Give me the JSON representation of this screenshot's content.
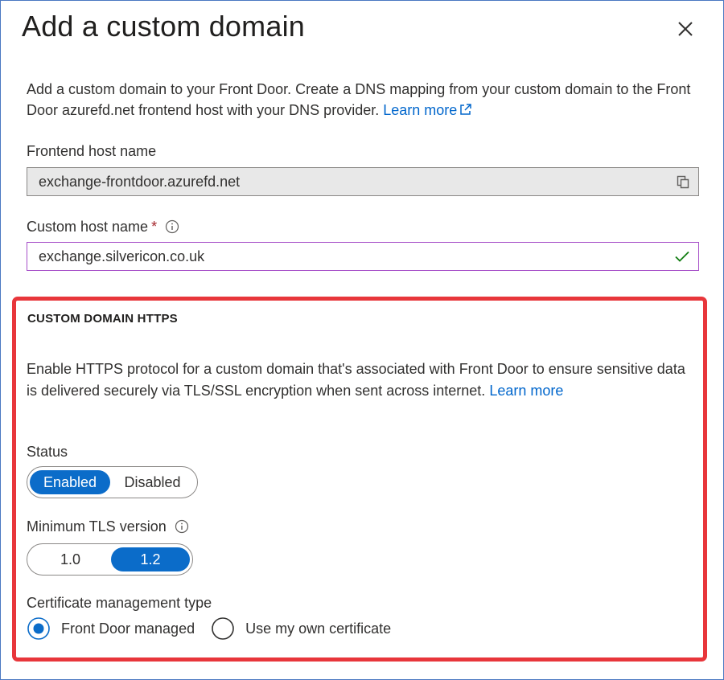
{
  "dialog": {
    "title": "Add a custom domain",
    "intro_text": "Add a custom domain to your Front Door. Create a DNS mapping from your custom domain to the Front Door azurefd.net frontend host with your DNS provider.",
    "learn_more_label": "Learn more"
  },
  "frontend_host": {
    "label": "Frontend host name",
    "value": "exchange-frontdoor.azurefd.net"
  },
  "custom_host": {
    "label": "Custom host name",
    "required_mark": "*",
    "value": "exchange.silvericon.co.uk"
  },
  "https_section": {
    "heading": "CUSTOM DOMAIN HTTPS",
    "description": "Enable HTTPS protocol for a custom domain that's associated with Front Door to ensure sensitive data is delivered securely via TLS/SSL encryption when sent across internet.",
    "learn_more_label": "Learn more",
    "status": {
      "label": "Status",
      "options": [
        "Enabled",
        "Disabled"
      ],
      "selected": "Enabled"
    },
    "tls": {
      "label": "Minimum TLS version",
      "options": [
        "1.0",
        "1.2"
      ],
      "selected": "1.2"
    },
    "cert": {
      "label": "Certificate management type",
      "options": [
        "Front Door managed",
        "Use my own certificate"
      ],
      "selected": "Front Door managed"
    }
  },
  "colors": {
    "accent": "#0b6cc9",
    "link": "#0066cc",
    "highlight_border": "#e8363b",
    "valid_check": "#107c10",
    "focus_border": "#a64fc8"
  },
  "icons": {
    "close": "close-icon",
    "external_link": "external-link-icon",
    "copy": "copy-icon",
    "info": "info-icon",
    "check": "checkmark-icon"
  }
}
